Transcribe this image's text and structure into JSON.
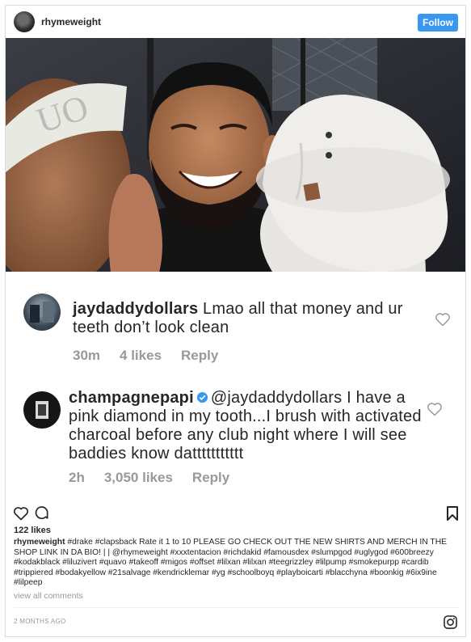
{
  "post": {
    "username": "rhymeweight",
    "follow_label": "Follow",
    "likes": "122 likes",
    "caption_user": "rhymeweight",
    "caption_text": "#drake #clapsback Rate it 1 to 10 PLEASE GO CHECK OUT THE NEW SHIRTS AND MERCH IN THE SHOP LINK IN DA BIO! | | @rhymeweight #xxxtentacion #richdakid #famousdex #slumpgod #uglygod #600breezy #kodakblack #liluzivert #quavo #takeoff #migos #offset #lilxan #lilxan #teegrizzley #lilpump #smokepurpp #cardib #trippiered #bodakyellow #21salvage #kendricklemar #yg #schoolboyq  #playboicarti #blacchyna #boonkig #6ix9ine #lilpeep",
    "view_all": "view all comments",
    "time_ago": "2 MONTHS AGO"
  },
  "comments": [
    {
      "user": "jaydaddydollars",
      "text": "Lmao all that money and ur teeth don’t look clean",
      "time": "30m",
      "likes": "4 likes",
      "reply": "Reply"
    },
    {
      "user": "champagnepapi",
      "text": "@jaydaddydollars I have a pink diamond in my tooth...I brush with activated charcoal before any club night where I will see baddies know dattttttttttt",
      "time": "2h",
      "likes": "3,050 likes",
      "reply": "Reply"
    }
  ],
  "icons": {
    "avatar": "avatar",
    "photo": "photo",
    "heart": "heart-icon",
    "comment": "comment-icon",
    "bookmark": "bookmark-icon",
    "verified": "verified-badge-icon",
    "instagram": "instagram-icon"
  },
  "colors": {
    "follow_button": "#3897f0",
    "verified_badge": "#3897f0",
    "muted_text": "#999999"
  }
}
